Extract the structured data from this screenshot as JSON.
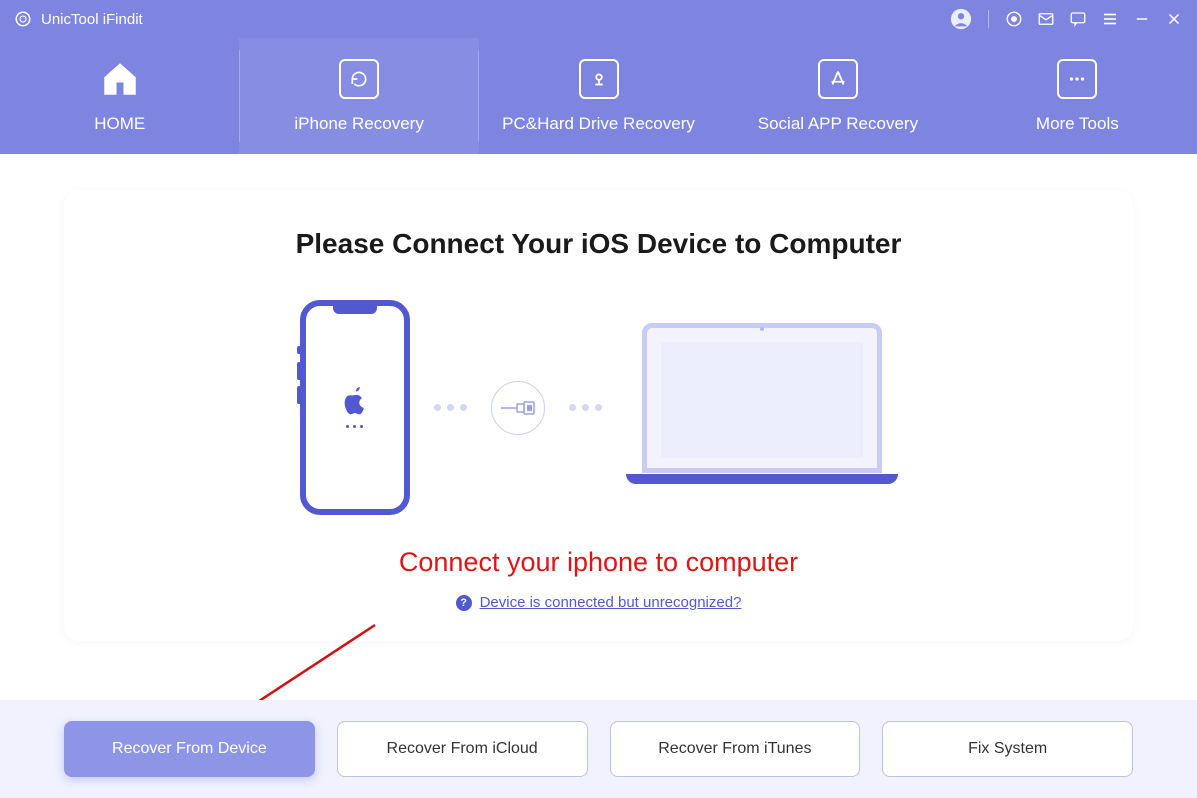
{
  "app": {
    "title": "UnicTool iFindit"
  },
  "nav": {
    "home": "HOME",
    "iphone_recovery": "iPhone Recovery",
    "pc_recovery": "PC&Hard Drive Recovery",
    "social_recovery": "Social APP Recovery",
    "more_tools": "More Tools"
  },
  "main": {
    "heading": "Please Connect Your iOS Device to Computer",
    "annotation": "Connect your iphone to computer",
    "help_link": "Device is connected but unrecognized?"
  },
  "buttons": {
    "recover_device": "Recover From Device",
    "recover_icloud": "Recover From iCloud",
    "recover_itunes": "Recover From iTunes",
    "fix_system": "Fix System"
  }
}
